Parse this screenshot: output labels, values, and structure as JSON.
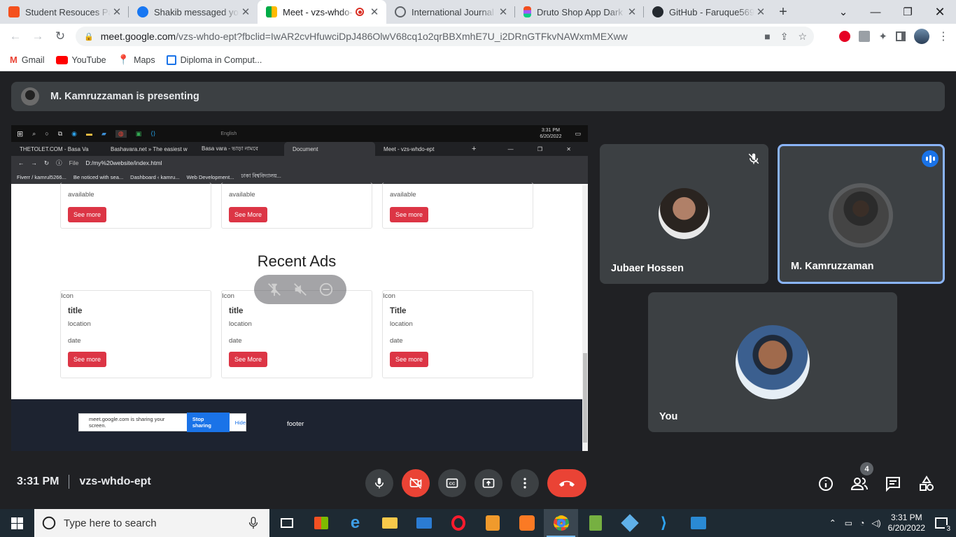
{
  "browser": {
    "tabs": [
      {
        "title": "Student Resouces Pap",
        "favicon": "#f4511e"
      },
      {
        "title": "Shakib messaged you",
        "favicon": "#1877f2"
      },
      {
        "title": "Meet - vzs-whdo-",
        "favicon": "#00ac47",
        "active": true
      },
      {
        "title": "International Journal o",
        "favicon": "#5f6368"
      },
      {
        "title": "Druto Shop App Dark",
        "favicon": "#a259ff"
      },
      {
        "title": "GitHub - Faruque5698",
        "favicon": "#24292f"
      }
    ],
    "url_host": "meet.google.com",
    "url_path": "/vzs-whdo-ept?fbclid=IwAR2cvHfuwciDpJ486OlwV68cq1o2qrBBXmhE7U_i2DRnGTFkvNAWxmMEXww",
    "bookmarks": [
      "Gmail",
      "YouTube",
      "Maps",
      "Diploma in Comput..."
    ]
  },
  "meet": {
    "presenter_banner": "M. Kamruzzaman is presenting",
    "time": "3:31 PM",
    "meeting_code": "vzs-whdo-ept",
    "participants_count": "4",
    "tiles": [
      {
        "name": "Jubaer Hossen"
      },
      {
        "name": "M. Kamruzzaman"
      },
      {
        "name": "You"
      }
    ]
  },
  "shared": {
    "clock": "3:31 PM",
    "date": "6/20/2022",
    "taskbar_lang": "English",
    "tabs": [
      "THETOLET.COM - Basa Va",
      "Bashavara.net » The easiest w",
      "Basa vara - ভাড়া নামবে",
      "Document",
      "Meet - vzs-whdo-ept"
    ],
    "address": "D:/my%20website/index.html",
    "address_prefix": "File",
    "bookmarks": [
      "Fiverr / kamrul5266...",
      "Be noticed with sea...",
      "Dashboard ‹ kamru...",
      "Web Development...",
      "ঢাকা বিশ্ববিদ্যালয়..."
    ],
    "top_cards": [
      {
        "status": "available",
        "button": "See more"
      },
      {
        "status": "available",
        "button": "See More"
      },
      {
        "status": "available",
        "button": "See more"
      }
    ],
    "heading": "Recent Ads",
    "cards": [
      {
        "img_alt": "Icon",
        "title": "title",
        "location": "location",
        "date": "date",
        "button": "See more"
      },
      {
        "img_alt": "Icon",
        "title": "title",
        "location": "location",
        "date": "date",
        "button": "See More"
      },
      {
        "img_alt": "Icon",
        "title": "Title",
        "location": "location",
        "date": "date",
        "button": "See more"
      }
    ],
    "footer": "footer",
    "sharing_text": "meet.google.com is sharing your screen.",
    "stop_sharing": "Stop sharing",
    "hide": "Hide"
  },
  "taskbar": {
    "search_placeholder": "Type here to search",
    "time": "3:31 PM",
    "date": "6/20/2022",
    "notifications": "3"
  }
}
